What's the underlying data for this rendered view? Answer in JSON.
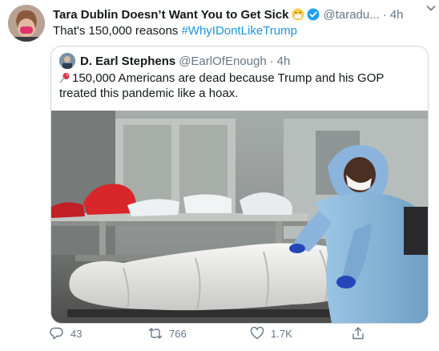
{
  "tweet": {
    "author_name": "Tara Dublin Doesn’t Want You to Get Sick",
    "handle": "@taradu...",
    "separator": "·",
    "time": "4h",
    "text_prefix": "That's 150,000 reasons ",
    "hashtag": "#WhyIDontLikeTrump"
  },
  "quoted": {
    "author_name": "D. Earl Stephens",
    "handle": "@EarlOfEnough",
    "separator": "·",
    "time": "4h",
    "text": "150,000 Americans are dead because Trump and his GOP treated this pandemic like a hoax."
  },
  "actions": {
    "replies": "43",
    "retweets": "766",
    "likes": "1.7K"
  },
  "colors": {
    "link": "#1b95e0",
    "muted": "#657786",
    "border": "#ccd6dd"
  },
  "icons": [
    "avatar",
    "mask-face-emoji",
    "verified-badge-icon",
    "chevron-down-icon",
    "pushpin-icon",
    "reply-icon",
    "retweet-icon",
    "like-icon",
    "share-icon"
  ]
}
